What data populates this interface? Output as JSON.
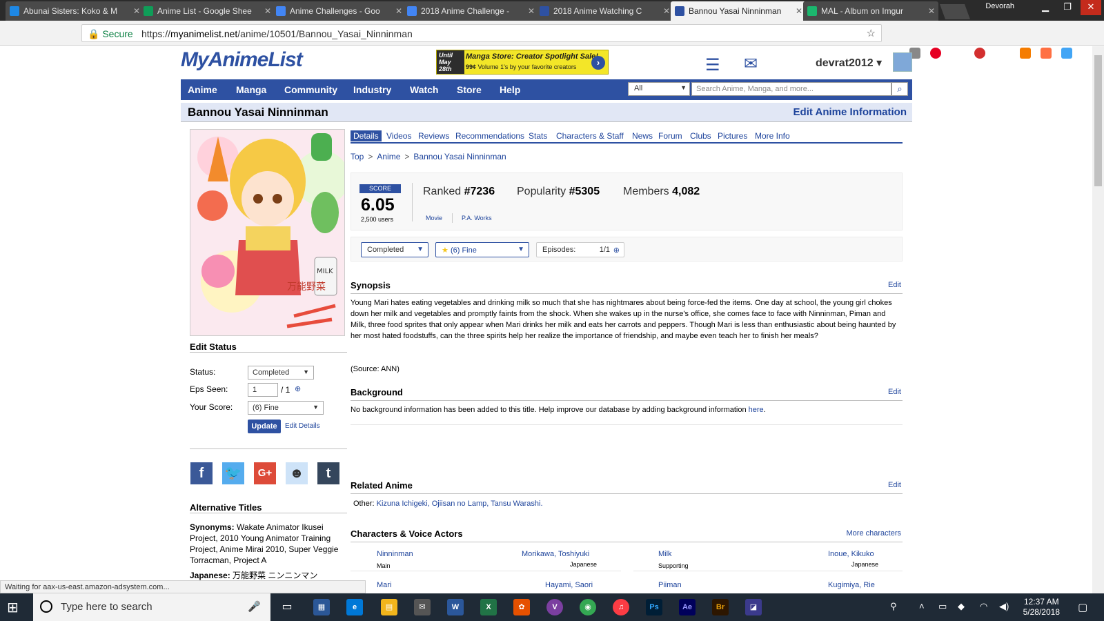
{
  "browser": {
    "tabs": [
      {
        "title": "Abunai Sisters: Koko & M",
        "color": "#1e88e5",
        "active": false
      },
      {
        "title": "Anime List - Google Shee",
        "color": "#0f9d58",
        "active": false
      },
      {
        "title": "Anime Challenges - Goo",
        "color": "#4285f4",
        "active": false
      },
      {
        "title": "2018 Anime Challenge - ",
        "color": "#4285f4",
        "active": false
      },
      {
        "title": "2018 Anime Watching C",
        "color": "#2e51a2",
        "active": false
      },
      {
        "title": "Bannou Yasai Ninninman",
        "color": "#2e51a2",
        "active": true
      },
      {
        "title": "MAL - Album on Imgur",
        "color": "#1bb76e",
        "active": false
      }
    ],
    "profile_name": "Devorah",
    "secure_label": "Secure",
    "url_scheme": "https://",
    "url_domain": "myanimelist.net",
    "url_path": "/anime/10501/Bannou_Yasai_Ninninman",
    "status_text": "Waiting for aax-us-east.amazon-adsystem.com..."
  },
  "header": {
    "logo": "MyAnimeList",
    "banner": {
      "date": "Until May 28th",
      "headline": "Manga Store: Creator Spotlight Sale!",
      "price": "99¢",
      "sub": "Volume 1's by your favorite creators"
    },
    "username": "devrat2012"
  },
  "nav": {
    "items": [
      "Anime",
      "Manga",
      "Community",
      "Industry",
      "Watch",
      "Store",
      "Help"
    ],
    "search_category": "All",
    "search_placeholder": "Search Anime, Manga, and more..."
  },
  "title": {
    "text": "Bannou Yasai Ninninman",
    "edit_label": "Edit Anime Information"
  },
  "sidebar": {
    "edit_status_title": "Edit Status",
    "status_label": "Status:",
    "status_value": "Completed",
    "eps_label": "Eps Seen:",
    "eps_value": "1",
    "eps_total": "/ 1",
    "score_label": "Your Score:",
    "score_value": "(6) Fine",
    "update_label": "Update",
    "edit_details_label": "Edit Details",
    "alt_titles_title": "Alternative Titles",
    "synonyms_label": "Synonyms:",
    "synonyms_value": "Wakate Animator Ikusei Project, 2010 Young Animator Training Project, Anime Mirai 2010, Super Veggie Torracman, Project A",
    "japanese_label": "Japanese:",
    "japanese_value": "万能野菜 ニンニンマン"
  },
  "details_tabs": [
    "Details",
    "Videos",
    "Reviews",
    "Recommendations",
    "Stats",
    "Characters & Staff",
    "News",
    "Forum",
    "Clubs",
    "Pictures",
    "More Info"
  ],
  "breadcrumb": [
    "Top",
    "Anime",
    "Bannou Yasai Ninninman"
  ],
  "stats": {
    "score_label": "SCORE",
    "score": "6.05",
    "users": "2,500 users",
    "ranked_label": "Ranked",
    "ranked": "#7236",
    "popularity_label": "Popularity",
    "popularity": "#5305",
    "members_label": "Members",
    "members": "4,082",
    "type": "Movie",
    "studio": "P.A. Works"
  },
  "status_bar": {
    "status": "Completed",
    "score": "(6) Fine",
    "episodes_label": "Episodes:",
    "episodes": "1/1"
  },
  "synopsis": {
    "title": "Synopsis",
    "edit": "Edit",
    "text": "Young Mari hates eating vegetables and drinking milk so much that she has nightmares about being force-fed the items. One day at school, the young girl chokes down her milk and vegetables and promptly faints from the shock. When she wakes up in the nurse's office, she comes face to face with Ninninman, Piman and Milk, three food sprites that only appear when Mari drinks her milk and eats her carrots and peppers. Though Mari is less than enthusiastic about being haunted by her most hated foodstuffs, can the three spirits help her realize the importance of friendship, and maybe even teach her to finish her meals?",
    "source": "(Source: ANN)"
  },
  "background": {
    "title": "Background",
    "edit": "Edit",
    "text": "No background information has been added to this title. Help improve our database by adding background information ",
    "link": "here",
    "end": "."
  },
  "related": {
    "title": "Related Anime",
    "edit": "Edit",
    "other_label": "Other:",
    "items": "Kizuna Ichigeki, Ojiisan no Lamp, Tansu Warashi."
  },
  "characters": {
    "title": "Characters & Voice Actors",
    "more": "More characters",
    "rows": [
      {
        "name": "Ninninman",
        "role": "Main",
        "va": "Morikawa, Toshiyuki",
        "lang": "Japanese"
      },
      {
        "name": "Milk",
        "role": "Supporting",
        "va": "Inoue, Kikuko",
        "lang": "Japanese"
      },
      {
        "name": "Mari",
        "role": "",
        "va": "Hayami, Saori",
        "lang": ""
      },
      {
        "name": "Piiman",
        "role": "",
        "va": "Kugimiya, Rie",
        "lang": ""
      }
    ]
  },
  "taskbar": {
    "search_placeholder": "Type here to search",
    "time": "12:37 AM",
    "date": "5/28/2018"
  },
  "cover_text": {
    "milk": "MILK",
    "title_jp": "万能野菜"
  }
}
